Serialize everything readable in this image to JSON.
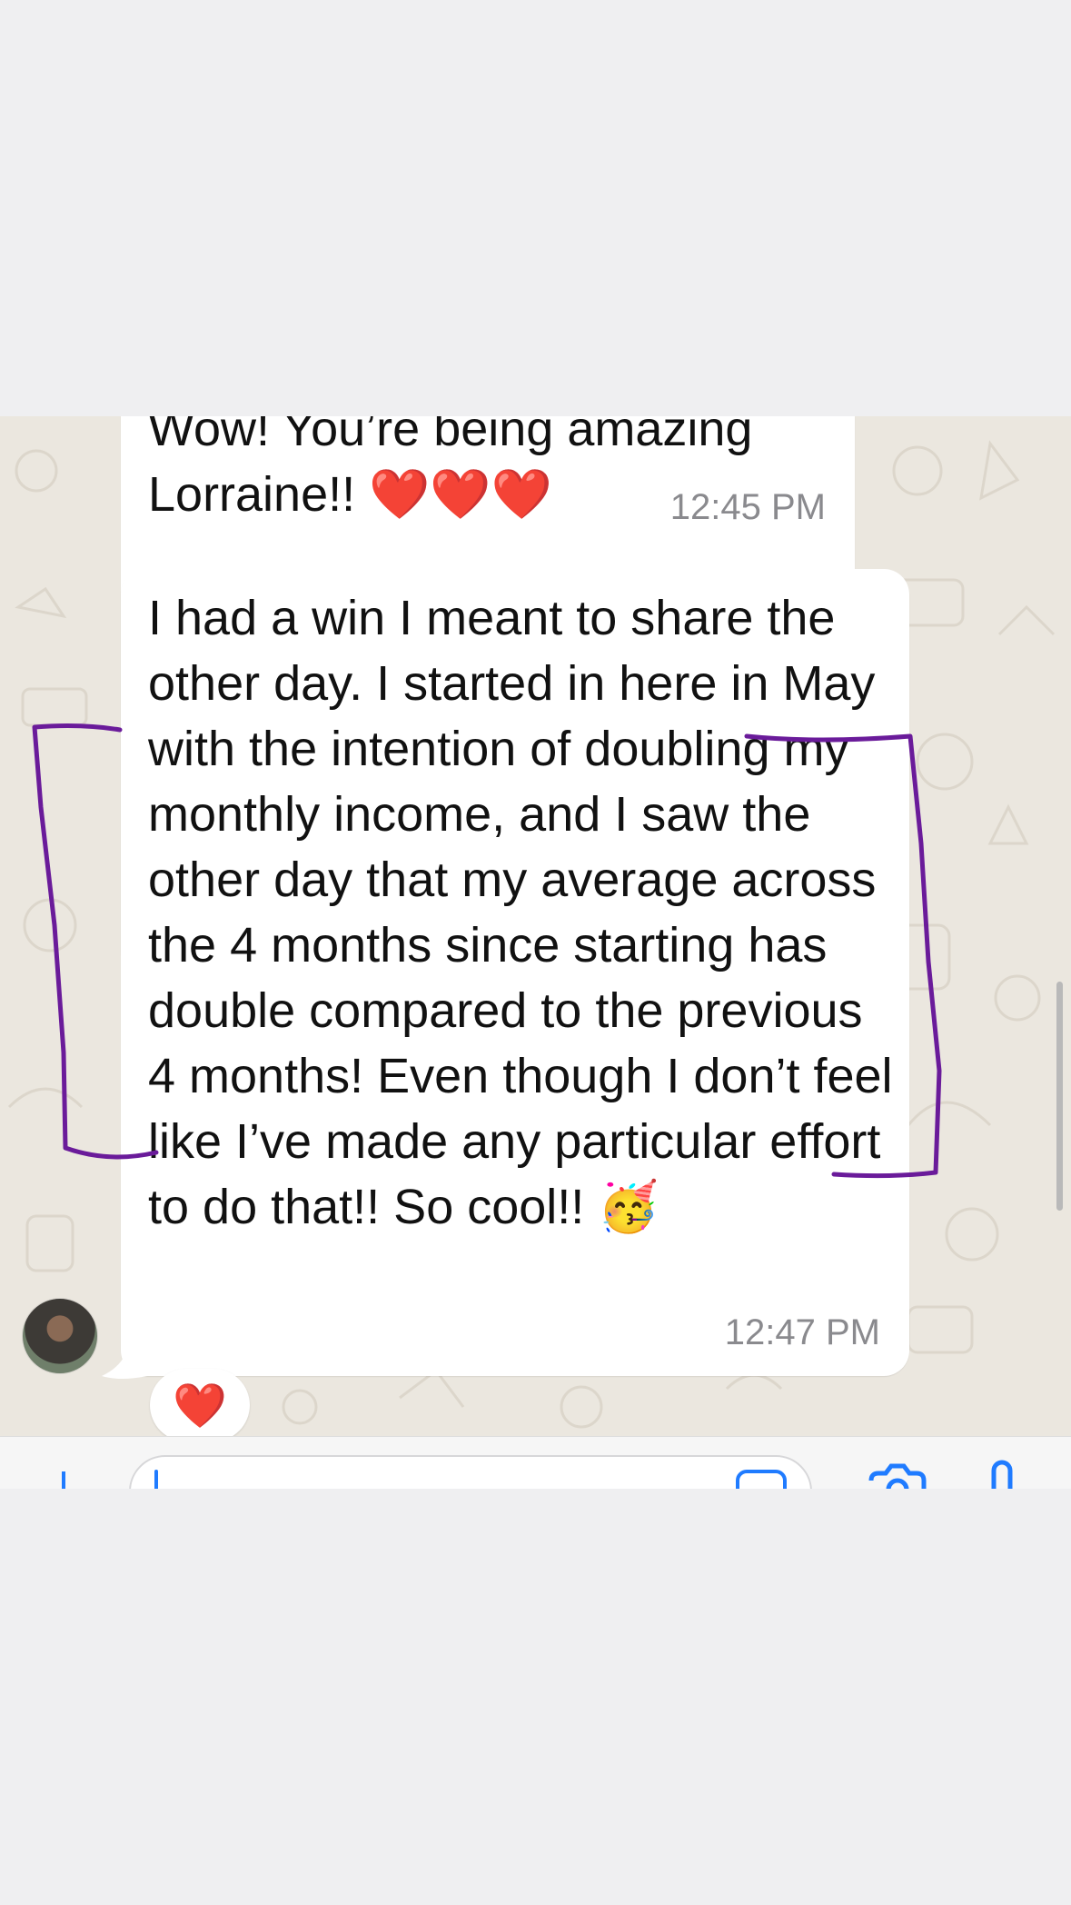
{
  "messages": [
    {
      "text": "Wow! You’re being amazing Lorraine!! ❤️❤️❤️",
      "time": "12:45 PM"
    },
    {
      "text": "I had a win I meant to share the other day. I started in here in May with the intention of doubling my monthly income, and I saw the other day that my average across the 4 months since starting has double compared to the previous 4 months! Even though I don’t feel like I’ve made any particular effort to do that!! So cool!! 🥳",
      "time": "12:47 PM",
      "reaction": "❤️"
    }
  ],
  "colors": {
    "chat_background": "#ebe7df",
    "bubble": "#ffffff",
    "accent": "#1f7bff",
    "annotation": "#6a1b9a",
    "timestamp": "#8a8a8e"
  },
  "icons": [
    "plus-icon",
    "sticker-icon",
    "camera-icon",
    "microphone-icon"
  ]
}
